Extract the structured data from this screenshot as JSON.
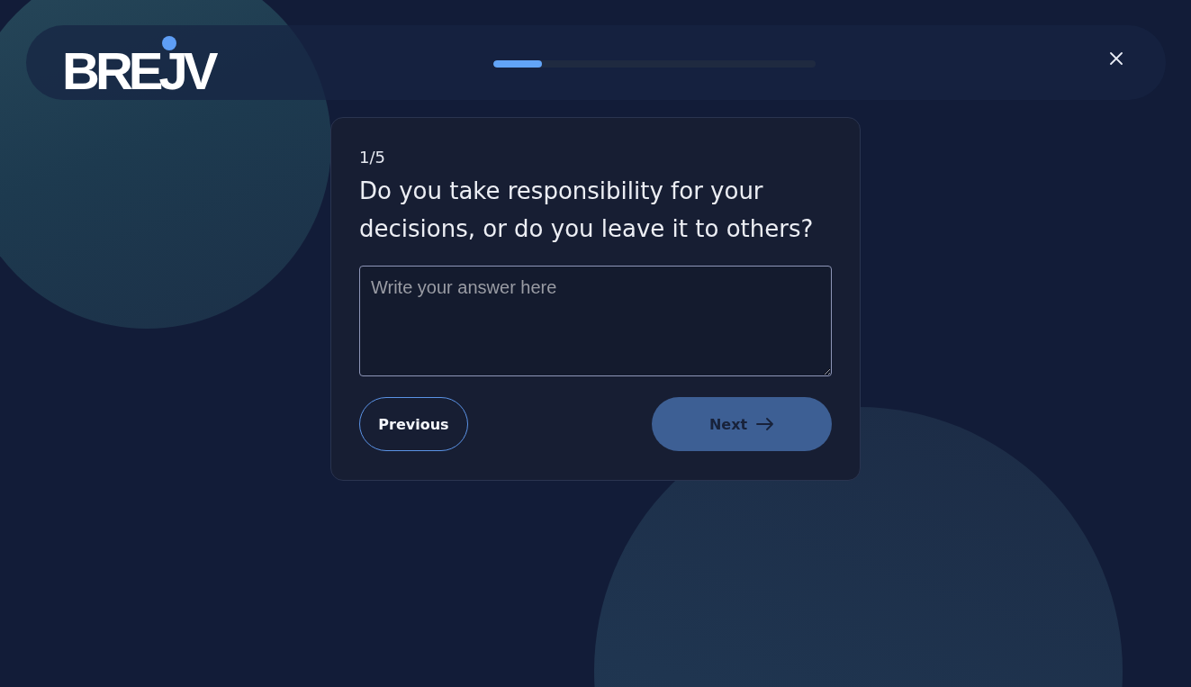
{
  "header": {
    "logo": "BREJV",
    "progress": {
      "level": 0.15
    }
  },
  "question_card": {
    "counter": "1/5",
    "question": "Do you take responsibility for your decisions, or do you leave it to others?",
    "answer": {
      "placeholder": "Write your answer here"
    },
    "buttons": [
      {
        "label": "Previous",
        "kind": "outline",
        "disabled": false
      },
      {
        "label": "Next",
        "kind": "primary",
        "disabled": true
      }
    ]
  }
}
